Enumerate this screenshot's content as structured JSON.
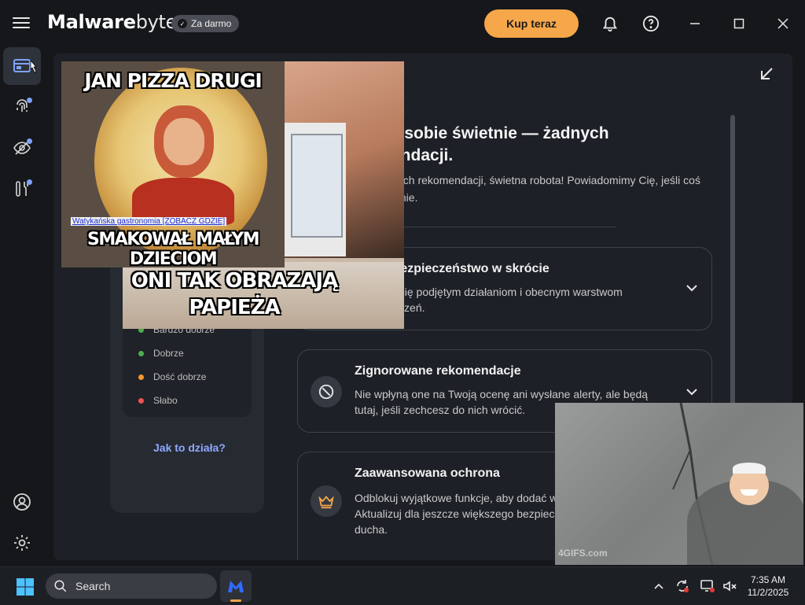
{
  "app": {
    "logo_bold": "Malware",
    "logo_light": "bytes",
    "plan_badge": "Za darmo",
    "buy_label": "Kup teraz"
  },
  "main": {
    "heading_line1": "z sobie świetnie — żadnych",
    "heading_line2": "endacji.",
    "subtext_line1": "nych rekomendacji, świetna robota! Powiadomimy Cię, jeśli coś",
    "subtext_line2": "ianie."
  },
  "cards": [
    {
      "title": "Twoje bezpieczeństwo w skrócie",
      "desc": "Przyjrzyj się podjętym działaniom i obecnym warstwom zabezpieczeń."
    },
    {
      "title": "Zignorowane rekomendacje",
      "desc": "Nie wpłyną one na Twoją ocenę ani wysłane alerty, ale będą tutaj, jeśli zechcesz do nich wrócić."
    },
    {
      "title": "Zaawansowana ochrona",
      "desc": "Odblokuj wyjątkowe funkcje, aby dodać w Aktualizuj dla jeszcze większego bezpiec ducha."
    }
  ],
  "left_panel": {
    "legend": [
      {
        "label": "Bardzo dobrze",
        "color": "#4caf50"
      },
      {
        "label": "Dobrze",
        "color": "#4caf50"
      },
      {
        "label": "Dość dobrze",
        "color": "#f39a2a"
      },
      {
        "label": "Słabo",
        "color": "#ef5350"
      }
    ],
    "how_link": "Jak to działa?"
  },
  "overlays": {
    "meme1_top": "JAN PIZZA DRUGI",
    "meme1_bottom": "SMAKOWAŁ MAŁYM DZIECIOM",
    "meme1_link": "Watykańska gastronomia [ZOBACZ GDZIE]",
    "meme2_bottom_line1": "ONI TAK OBRAZAJĄ",
    "meme2_bottom_line2": "PAPIEŻA",
    "gif_watermark": "4GIFS.com"
  },
  "taskbar": {
    "search_label": "Search",
    "time": "7:35 AM",
    "date": "11/2/2025"
  },
  "colors": {
    "accent": "#f6a74a",
    "link": "#8fa8ff",
    "notify_dot": "#7fa2ff"
  }
}
